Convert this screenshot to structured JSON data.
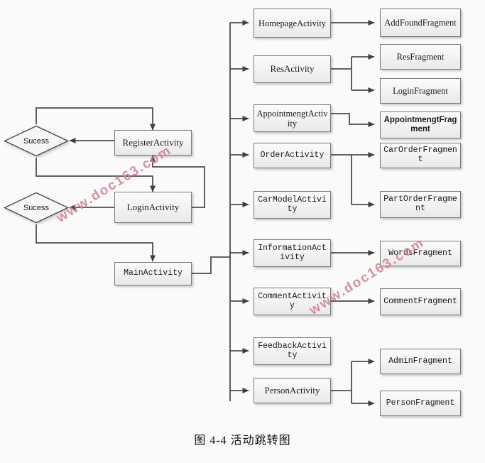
{
  "caption": "图 4-4  活动跳转图",
  "colors": {
    "background": "#fafafa",
    "box_border": "#7a7a7a",
    "box_fill_top": "#fbfbfb",
    "box_fill_bottom": "#e9e9e9",
    "line": "#4d4d4d",
    "text": "#1b1b1b",
    "watermark": "#d07f8c"
  },
  "watermarks": [
    {
      "text": "www.doc163.com",
      "size": 19
    },
    {
      "text": "www.doc163.com",
      "size": 19
    }
  ],
  "decisions": [
    {
      "label": "Sucess"
    },
    {
      "label": "Sucess"
    }
  ],
  "auth_nodes": [
    {
      "label": "RegisterActivity"
    },
    {
      "label": "LoginActivity"
    },
    {
      "label": "MainActivity"
    }
  ],
  "activities": [
    {
      "label": "HomepageActivity"
    },
    {
      "label": "ResActivity"
    },
    {
      "label": "AppointmengtActivity"
    },
    {
      "label": "OrderActivity"
    },
    {
      "label": "CarModelActivity"
    },
    {
      "label": "InformationActivity"
    },
    {
      "label": "CommentActivity"
    },
    {
      "label": "FeedbackActivity"
    },
    {
      "label": "PersonActivity"
    }
  ],
  "fragments": [
    {
      "label": "AddFoundFragment"
    },
    {
      "label": "ResFragment"
    },
    {
      "label": "LoginFragment"
    },
    {
      "label": "AppointmengtFragment"
    },
    {
      "label": "CarOrderFragment"
    },
    {
      "label": "PartOrderFragment"
    },
    {
      "label": "WordsFragment"
    },
    {
      "label": "CommentFragment"
    },
    {
      "label": "AdminFragment"
    },
    {
      "label": "PersonFragment"
    }
  ]
}
